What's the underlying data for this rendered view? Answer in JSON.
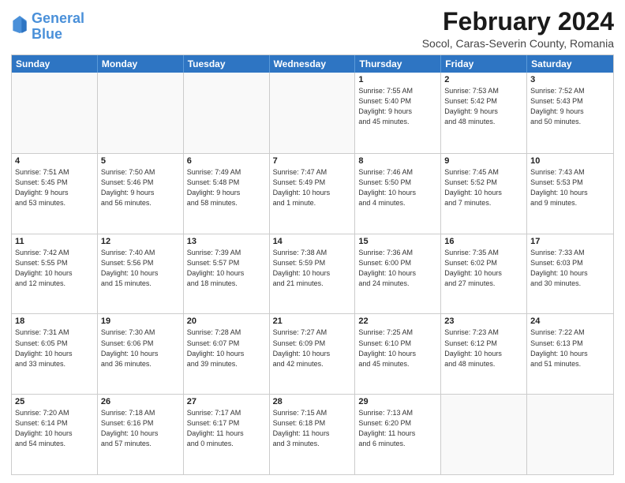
{
  "header": {
    "logo_line1": "General",
    "logo_line2": "Blue",
    "month": "February 2024",
    "location": "Socol, Caras-Severin County, Romania"
  },
  "days_of_week": [
    "Sunday",
    "Monday",
    "Tuesday",
    "Wednesday",
    "Thursday",
    "Friday",
    "Saturday"
  ],
  "weeks": [
    [
      {
        "day": "",
        "info": ""
      },
      {
        "day": "",
        "info": ""
      },
      {
        "day": "",
        "info": ""
      },
      {
        "day": "",
        "info": ""
      },
      {
        "day": "1",
        "info": "Sunrise: 7:55 AM\nSunset: 5:40 PM\nDaylight: 9 hours\nand 45 minutes."
      },
      {
        "day": "2",
        "info": "Sunrise: 7:53 AM\nSunset: 5:42 PM\nDaylight: 9 hours\nand 48 minutes."
      },
      {
        "day": "3",
        "info": "Sunrise: 7:52 AM\nSunset: 5:43 PM\nDaylight: 9 hours\nand 50 minutes."
      }
    ],
    [
      {
        "day": "4",
        "info": "Sunrise: 7:51 AM\nSunset: 5:45 PM\nDaylight: 9 hours\nand 53 minutes."
      },
      {
        "day": "5",
        "info": "Sunrise: 7:50 AM\nSunset: 5:46 PM\nDaylight: 9 hours\nand 56 minutes."
      },
      {
        "day": "6",
        "info": "Sunrise: 7:49 AM\nSunset: 5:48 PM\nDaylight: 9 hours\nand 58 minutes."
      },
      {
        "day": "7",
        "info": "Sunrise: 7:47 AM\nSunset: 5:49 PM\nDaylight: 10 hours\nand 1 minute."
      },
      {
        "day": "8",
        "info": "Sunrise: 7:46 AM\nSunset: 5:50 PM\nDaylight: 10 hours\nand 4 minutes."
      },
      {
        "day": "9",
        "info": "Sunrise: 7:45 AM\nSunset: 5:52 PM\nDaylight: 10 hours\nand 7 minutes."
      },
      {
        "day": "10",
        "info": "Sunrise: 7:43 AM\nSunset: 5:53 PM\nDaylight: 10 hours\nand 9 minutes."
      }
    ],
    [
      {
        "day": "11",
        "info": "Sunrise: 7:42 AM\nSunset: 5:55 PM\nDaylight: 10 hours\nand 12 minutes."
      },
      {
        "day": "12",
        "info": "Sunrise: 7:40 AM\nSunset: 5:56 PM\nDaylight: 10 hours\nand 15 minutes."
      },
      {
        "day": "13",
        "info": "Sunrise: 7:39 AM\nSunset: 5:57 PM\nDaylight: 10 hours\nand 18 minutes."
      },
      {
        "day": "14",
        "info": "Sunrise: 7:38 AM\nSunset: 5:59 PM\nDaylight: 10 hours\nand 21 minutes."
      },
      {
        "day": "15",
        "info": "Sunrise: 7:36 AM\nSunset: 6:00 PM\nDaylight: 10 hours\nand 24 minutes."
      },
      {
        "day": "16",
        "info": "Sunrise: 7:35 AM\nSunset: 6:02 PM\nDaylight: 10 hours\nand 27 minutes."
      },
      {
        "day": "17",
        "info": "Sunrise: 7:33 AM\nSunset: 6:03 PM\nDaylight: 10 hours\nand 30 minutes."
      }
    ],
    [
      {
        "day": "18",
        "info": "Sunrise: 7:31 AM\nSunset: 6:05 PM\nDaylight: 10 hours\nand 33 minutes."
      },
      {
        "day": "19",
        "info": "Sunrise: 7:30 AM\nSunset: 6:06 PM\nDaylight: 10 hours\nand 36 minutes."
      },
      {
        "day": "20",
        "info": "Sunrise: 7:28 AM\nSunset: 6:07 PM\nDaylight: 10 hours\nand 39 minutes."
      },
      {
        "day": "21",
        "info": "Sunrise: 7:27 AM\nSunset: 6:09 PM\nDaylight: 10 hours\nand 42 minutes."
      },
      {
        "day": "22",
        "info": "Sunrise: 7:25 AM\nSunset: 6:10 PM\nDaylight: 10 hours\nand 45 minutes."
      },
      {
        "day": "23",
        "info": "Sunrise: 7:23 AM\nSunset: 6:12 PM\nDaylight: 10 hours\nand 48 minutes."
      },
      {
        "day": "24",
        "info": "Sunrise: 7:22 AM\nSunset: 6:13 PM\nDaylight: 10 hours\nand 51 minutes."
      }
    ],
    [
      {
        "day": "25",
        "info": "Sunrise: 7:20 AM\nSunset: 6:14 PM\nDaylight: 10 hours\nand 54 minutes."
      },
      {
        "day": "26",
        "info": "Sunrise: 7:18 AM\nSunset: 6:16 PM\nDaylight: 10 hours\nand 57 minutes."
      },
      {
        "day": "27",
        "info": "Sunrise: 7:17 AM\nSunset: 6:17 PM\nDaylight: 11 hours\nand 0 minutes."
      },
      {
        "day": "28",
        "info": "Sunrise: 7:15 AM\nSunset: 6:18 PM\nDaylight: 11 hours\nand 3 minutes."
      },
      {
        "day": "29",
        "info": "Sunrise: 7:13 AM\nSunset: 6:20 PM\nDaylight: 11 hours\nand 6 minutes."
      },
      {
        "day": "",
        "info": ""
      },
      {
        "day": "",
        "info": ""
      }
    ]
  ]
}
